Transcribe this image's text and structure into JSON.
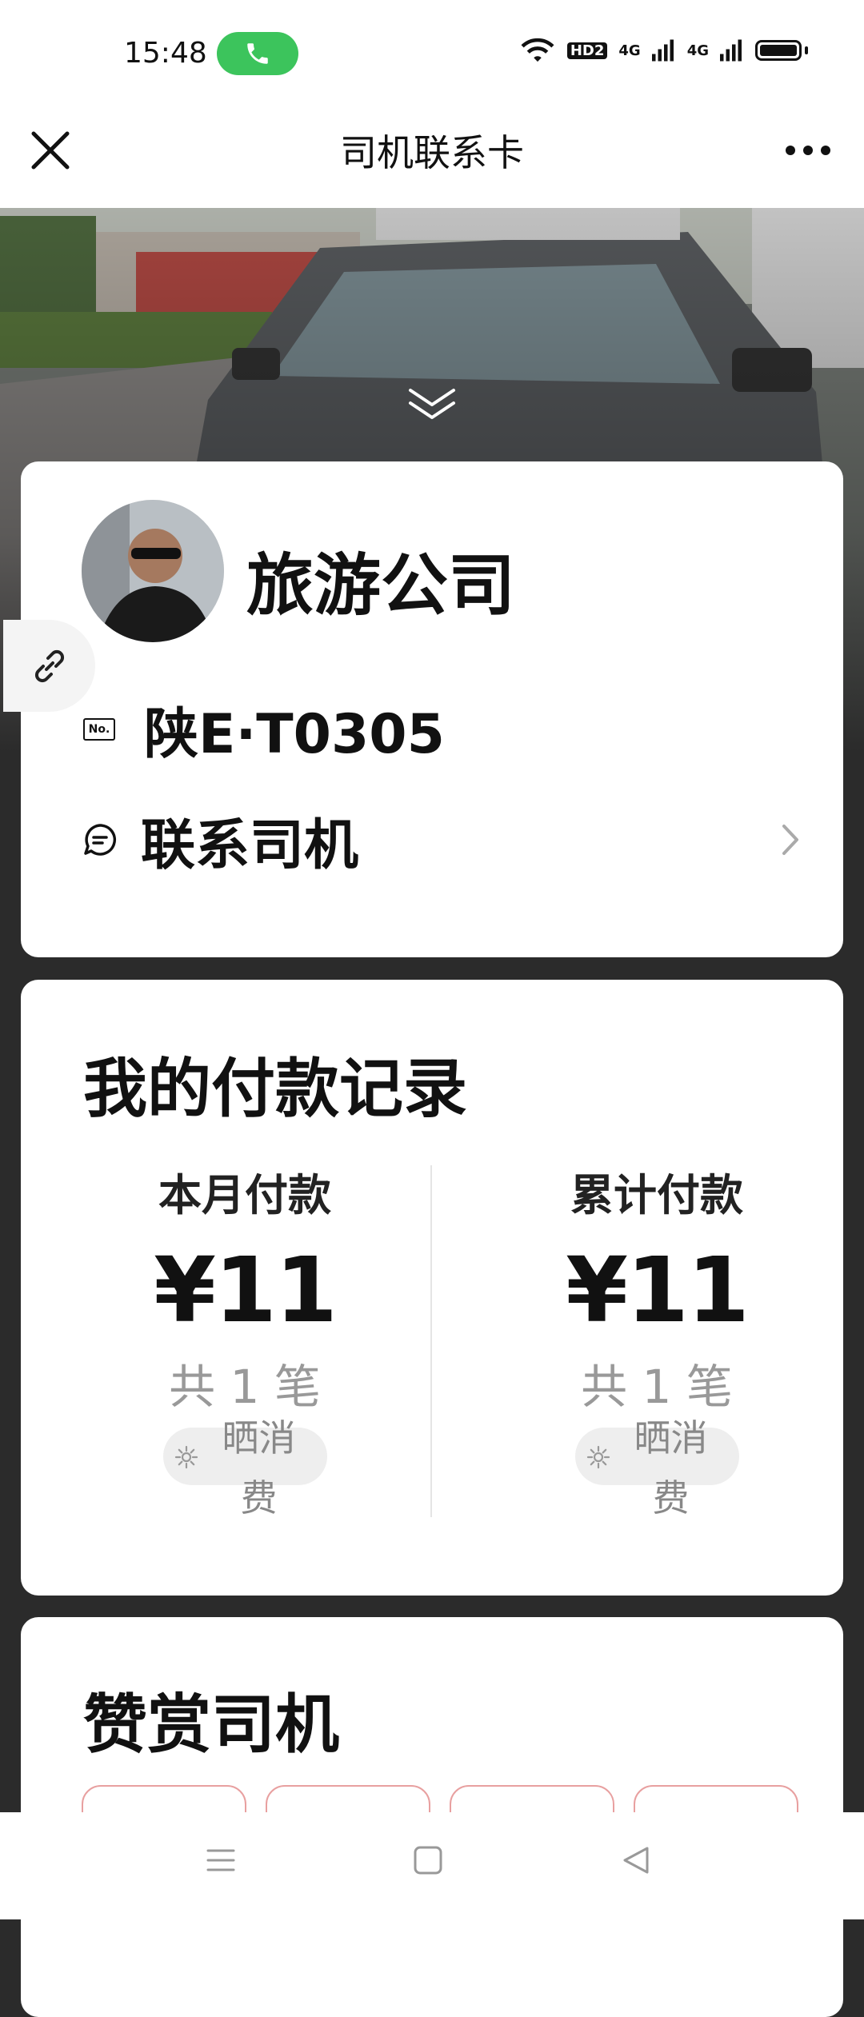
{
  "status_bar": {
    "time": "15:48",
    "network_1": "4G",
    "network_2": "4G",
    "hd_label": "HD2"
  },
  "nav": {
    "title": "司机联系卡"
  },
  "driver": {
    "company_name": "旅游公司",
    "plate": "陕E·T0305",
    "plate_icon_label": "No.",
    "contact_label": "联系司机"
  },
  "payments": {
    "title": "我的付款记录",
    "month": {
      "label": "本月付款",
      "amount": "¥11",
      "count": "共 1 笔",
      "share_label": "晒消费"
    },
    "total": {
      "label": "累计付款",
      "amount": "¥11",
      "count": "共 1 笔",
      "share_label": "晒消费"
    }
  },
  "tip": {
    "title": "赞赏司机"
  },
  "colors": {
    "call_green": "#3cc45c",
    "tip_border": "#e8a0a0",
    "page_bg": "#2b2b2b"
  },
  "icons": [
    "close-icon",
    "more-icon",
    "chevron-down-icon",
    "link-icon",
    "plate-icon",
    "chat-icon",
    "chevron-right-icon",
    "sun-icon",
    "menu-icon",
    "home-icon",
    "back-icon",
    "phone-icon",
    "wifi-icon",
    "signal-icon",
    "battery-icon"
  ]
}
